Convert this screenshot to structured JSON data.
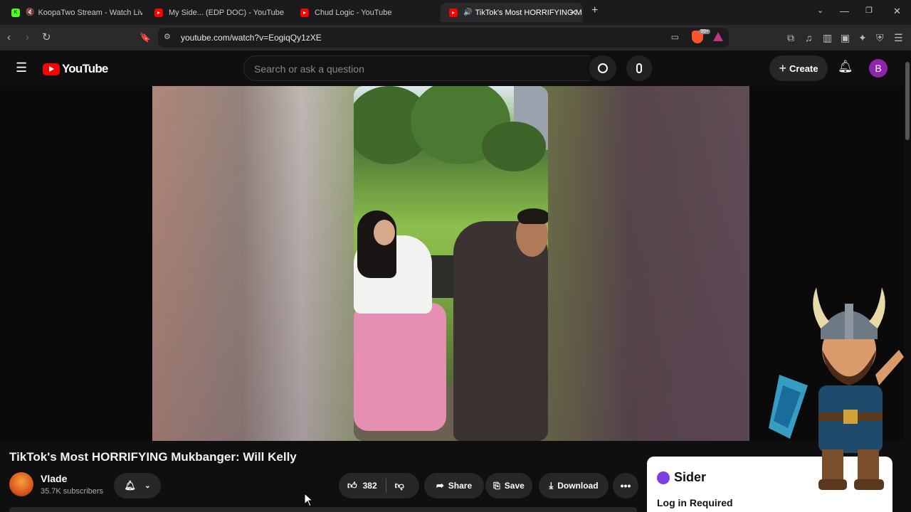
{
  "browser": {
    "tabs": [
      {
        "title": "KoopaTwo Stream - Watch Live o",
        "favicon": "kick-icon",
        "color": "#53fc18"
      },
      {
        "title": "My Side... (EDP DOC) - YouTube",
        "favicon": "youtube-icon",
        "color": "#ff0000"
      },
      {
        "title": "Chud Logic - YouTube",
        "favicon": "youtube-icon",
        "color": "#ff0000"
      },
      {
        "title": "TikTok's Most HORRIFYING M",
        "favicon": "youtube-icon",
        "color": "#ff0000",
        "active": true
      }
    ],
    "url": "youtube.com/watch?v=EogiqQy1zXE",
    "brave_badge": "99+"
  },
  "youtube": {
    "logo_text": "YouTube",
    "search_placeholder": "Search or ask a question",
    "create_label": "Create",
    "avatar_letter": "B"
  },
  "video": {
    "title": "TikTok's Most HORRIFYING Mukbanger: Will Kelly",
    "channel": "Vlade",
    "subscribers": "35.7K subscribers",
    "likes": "382",
    "share_label": "Share",
    "save_label": "Save",
    "download_label": "Download"
  },
  "sider": {
    "brand": "Sider",
    "message": "Log in Required"
  },
  "colors": {
    "youtube_red": "#ff0000",
    "avatar_purple": "#8e24aa",
    "sider_purple": "#7b3fe4"
  }
}
